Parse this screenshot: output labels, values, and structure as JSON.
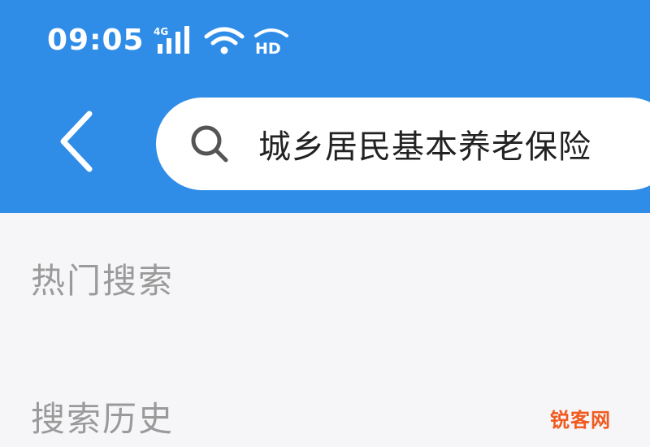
{
  "status_bar": {
    "time": "09:05",
    "icons": [
      "signal-4g-icon",
      "wifi-icon",
      "hd-icon"
    ]
  },
  "header": {
    "back_icon": "back-chevron-icon",
    "search": {
      "icon": "search-icon",
      "value": "城乡居民基本养老保险"
    }
  },
  "sections": {
    "hot_search": "热门搜索",
    "search_history": "搜索历史"
  },
  "colors": {
    "header": "#2f8de8",
    "background": "#f6f6f8",
    "section_text": "#9a9a9a",
    "watermark": "#f05a1e"
  },
  "watermark": "锐客网"
}
